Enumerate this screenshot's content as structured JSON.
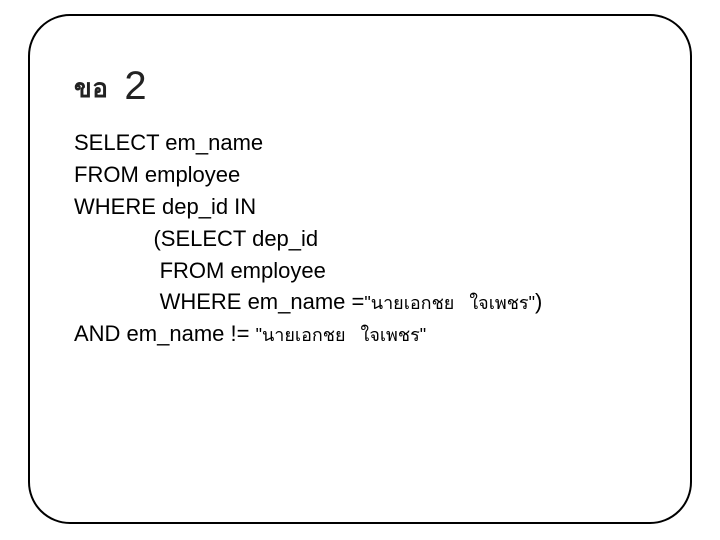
{
  "title": {
    "label": "ขอ",
    "number": "2"
  },
  "sql": {
    "l1": "SELECT em_name",
    "l2": "FROM employee",
    "l3": "WHERE dep_id IN",
    "l4": "             (SELECT dep_id",
    "l5": "              FROM employee",
    "l6_a": "              WHERE em_name =",
    "l6_b": "\"นายเอกชย   ใจเพชร\"",
    "l6_c": ")",
    "l7_a": "AND em_name != ",
    "l7_b": "\"นายเอกชย   ใจเพชร\""
  }
}
